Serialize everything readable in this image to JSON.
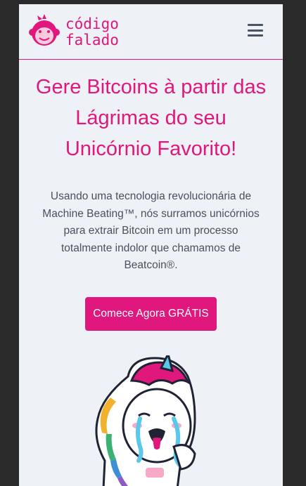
{
  "header": {
    "brand_line1": "código",
    "brand_line2": "falado",
    "logo_icon": "monkey-logo-icon",
    "menu_icon": "hamburger-menu-icon"
  },
  "hero": {
    "headline": "Gere Bitcoins à partir das Lágrimas do seu Unicórnio Favorito!",
    "description": "Usando uma tecnologia revolucionária de Machine Beating™, nós surramos unicórnios para extrair Bitcoin em um processo totalmente indolor que chamamos de Beatcoin®.",
    "cta_label": "Comece Agora GRÁTIS",
    "illustration_icon": "crying-unicorn-illustration"
  },
  "colors": {
    "accent": "#e0177c",
    "background": "#eef1f5",
    "text": "#4a5060",
    "outer": "#2a2a2a"
  }
}
